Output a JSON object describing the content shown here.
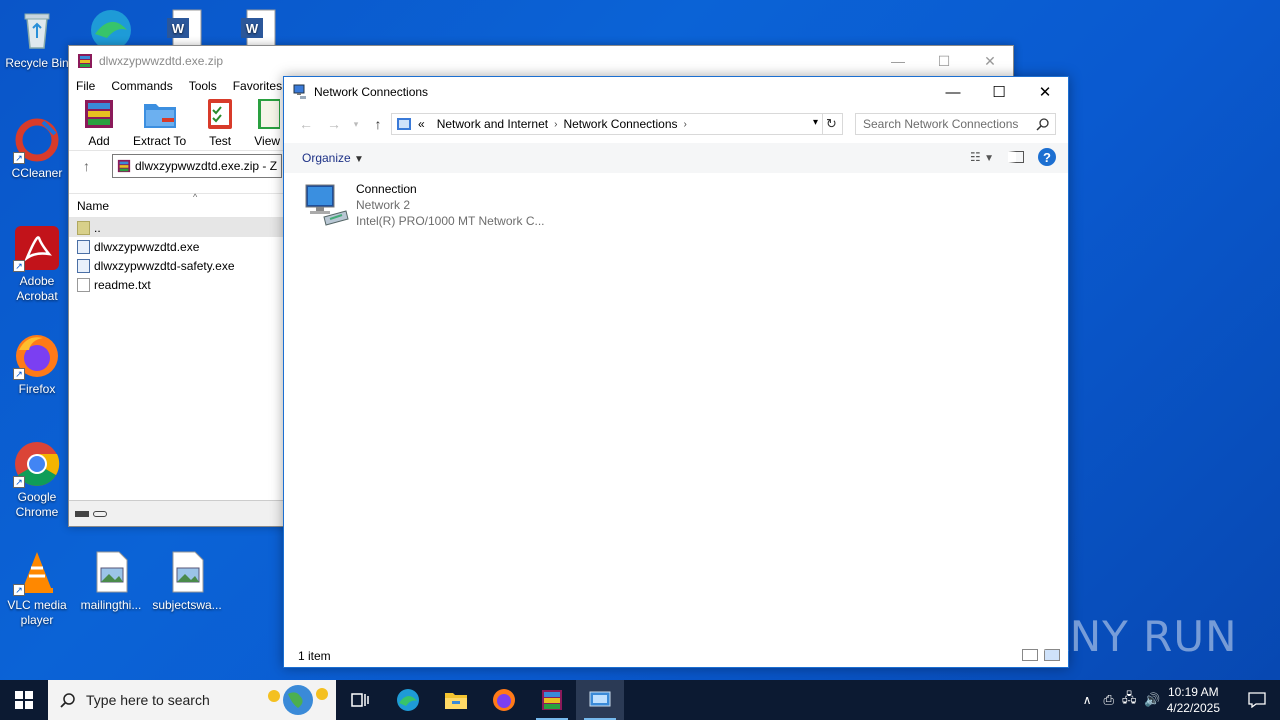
{
  "desktop": {
    "icons": [
      {
        "label": "Recycle Bin",
        "icon": "recycle-bin-icon"
      },
      {
        "label": "CCleaner",
        "icon": "ccleaner-icon"
      },
      {
        "label": "Adobe Acrobat",
        "icon": "acrobat-icon"
      },
      {
        "label": "Firefox",
        "icon": "firefox-icon"
      },
      {
        "label": "Google Chrome",
        "icon": "chrome-icon"
      },
      {
        "label": "VLC media player",
        "icon": "vlc-icon"
      },
      {
        "label": "mailingthi...",
        "icon": "image-file-icon"
      },
      {
        "label": "subjectswa...",
        "icon": "image-file-icon"
      }
    ]
  },
  "winrar": {
    "title": "dlwxzypwwzdtd.exe.zip",
    "menu": [
      "File",
      "Commands",
      "Tools",
      "Favorites"
    ],
    "toolbar": [
      {
        "label": "Add",
        "icon": "add-archive-icon"
      },
      {
        "label": "Extract To",
        "icon": "extract-folder-icon"
      },
      {
        "label": "Test",
        "icon": "test-clipboard-icon"
      },
      {
        "label": "View",
        "icon": "view-book-icon"
      }
    ],
    "address": "dlwxzypwwzdtd.exe.zip - Z",
    "column_name": "Name",
    "files": [
      {
        "name": "..",
        "type": "folder"
      },
      {
        "name": "dlwxzypwwzdtd.exe",
        "type": "exe"
      },
      {
        "name": "dlwxzypwwzdtd-safety.exe",
        "type": "exe"
      },
      {
        "name": "readme.txt",
        "type": "txt"
      }
    ]
  },
  "network": {
    "title": "Network Connections",
    "breadcrumb": [
      "«",
      "Network and Internet",
      "Network Connections"
    ],
    "search_placeholder": "Search Network Connections",
    "organize": "Organize",
    "item": {
      "name": "Connection",
      "network": "Network 2",
      "adapter": "Intel(R) PRO/1000 MT Network C..."
    },
    "status": "1 item"
  },
  "watermark": "ANY RUN",
  "taskbar": {
    "search_placeholder": "Type here to search",
    "time": "10:19 AM",
    "date": "4/22/2025",
    "accent": "#76b9ed"
  }
}
